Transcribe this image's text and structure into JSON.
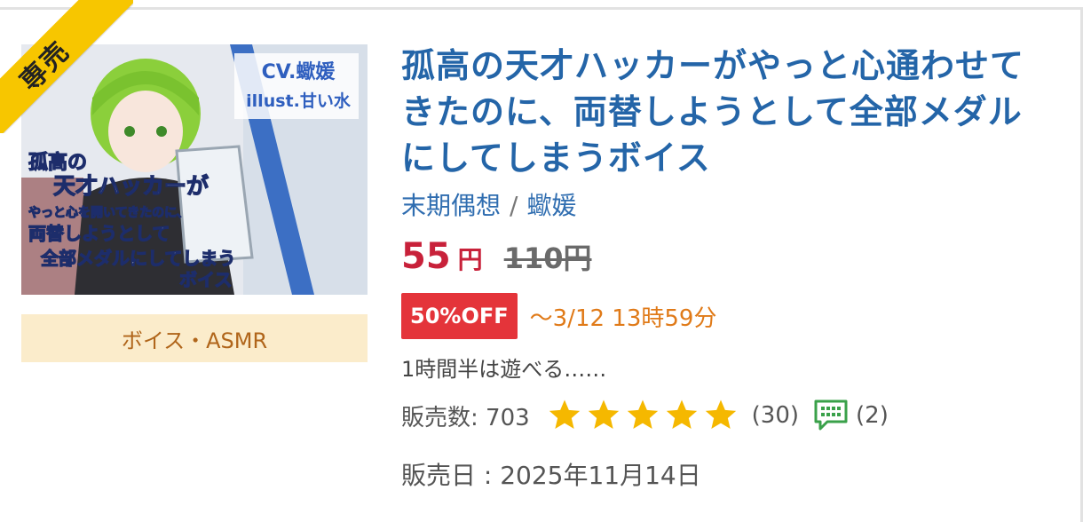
{
  "work": {
    "exclusive_badge": "専売",
    "category": "ボイス・ASMR",
    "title": "孤高の天才ハッカーがやっと心通わせてきたのに、両替しようとして全部メダルにしてしまうボイス",
    "circle": "末期偶想",
    "separator": "/",
    "voice_actor": "蠍媛",
    "price_now": "55",
    "price_unit": "円",
    "price_old": "110円",
    "discount_badge": "50%OFF",
    "sale_deadline": "～3/12 13時59分",
    "summary": "1時間半は遊べる……",
    "sales_label": "販売数: 703",
    "rating": 5,
    "rating_count": "(30)",
    "comment_count": "(2)",
    "release_label": "販売日 : 2025年11月14日"
  },
  "thumbnail": {
    "cv_text": "CV.蠍媛",
    "illust_text": "illust.甘い水",
    "title_lines": [
      "孤高の",
      "天才ハッカーが",
      "やっと心を開いてきたのに、",
      "両替しようとして",
      "全部メダルにしてしまう",
      "ボイス"
    ]
  },
  "colors": {
    "title_blue": "#2465a8",
    "price_red": "#c8213a",
    "sale_orange": "#e07a18",
    "star_yellow": "#f5b800",
    "badge_red": "#e4343a",
    "category_bg": "#fbeccb"
  },
  "icons": {
    "ribbon": "exclusive-ribbon",
    "star": "star-icon",
    "comment": "comment-icon"
  }
}
